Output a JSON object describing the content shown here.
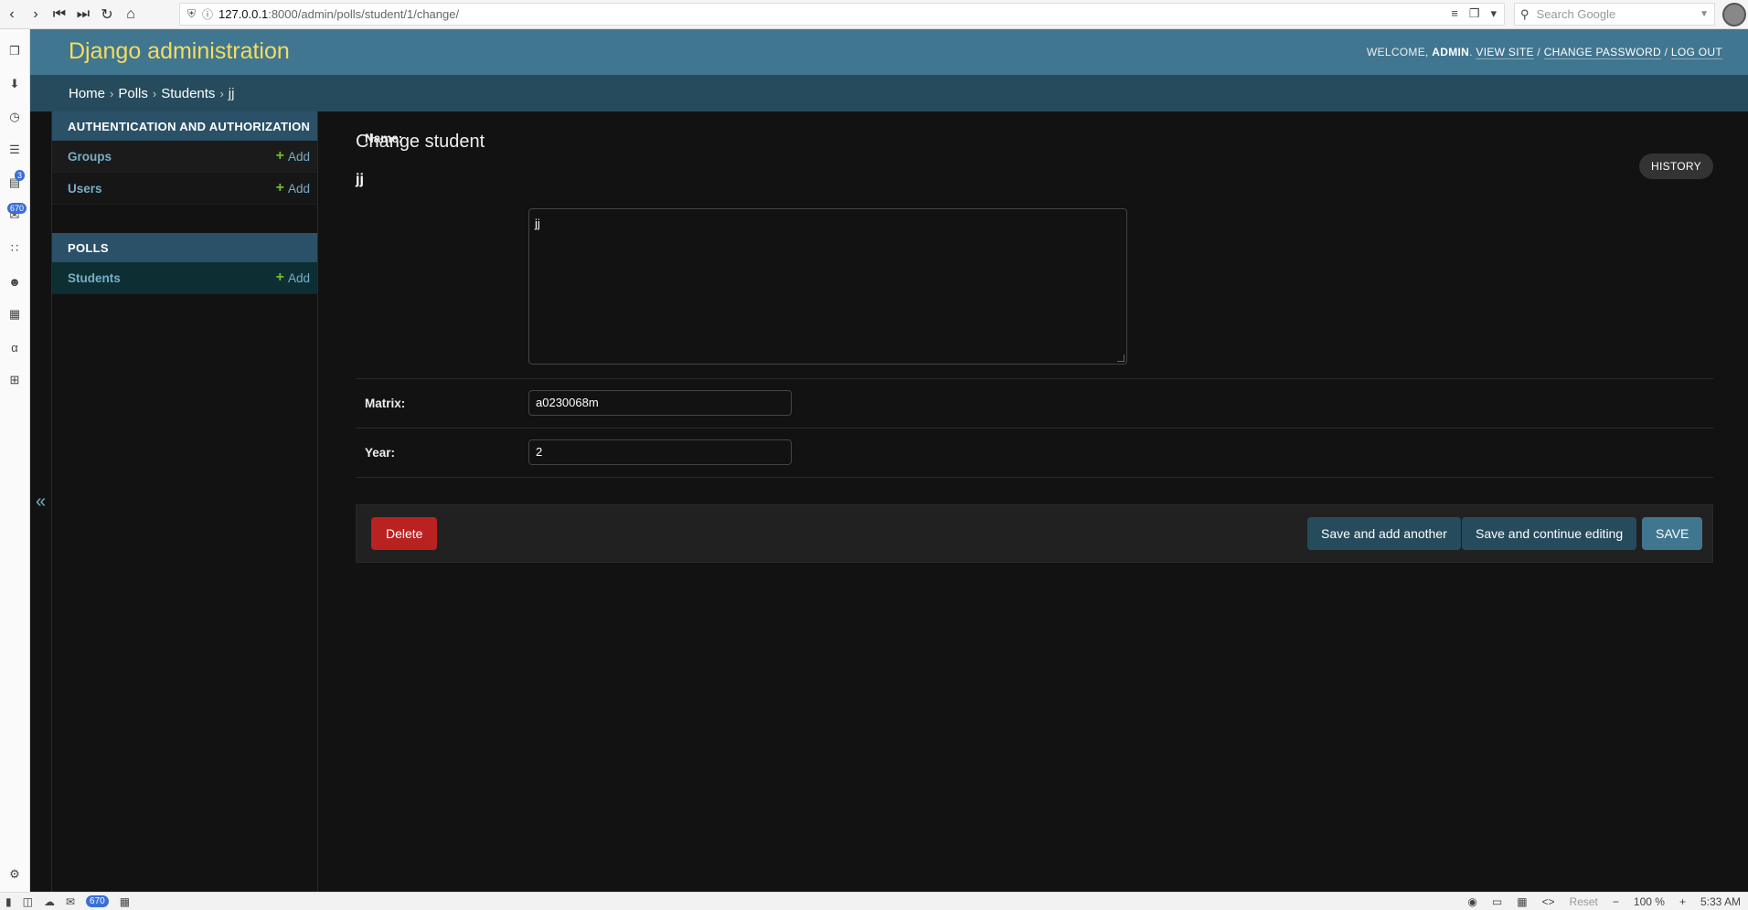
{
  "browser": {
    "url_host": "127.0.0.1",
    "url_path": ":8000/admin/polls/student/1/change/",
    "search_placeholder": "Search Google",
    "left_badges": [
      "3",
      "670"
    ],
    "status": {
      "mail_badge": "670",
      "reset_label": "Reset",
      "zoom": "100 %",
      "time": "5:33 AM"
    }
  },
  "header": {
    "branding": "Django administration",
    "welcome": "Welcome, ",
    "username": "admin",
    "view_site": "View site",
    "change_password": "Change password",
    "log_out": "Log out",
    "sep": " / "
  },
  "breadcrumbs": {
    "home": "Home",
    "app": "Polls",
    "model": "Students",
    "object": "jj",
    "sep": "›"
  },
  "sidebar": {
    "toggle": "«",
    "modules": [
      {
        "caption": "Authentication and Authorization",
        "models": [
          {
            "name": "Groups",
            "add": "Add"
          },
          {
            "name": "Users",
            "add": "Add"
          }
        ]
      },
      {
        "caption": "Polls",
        "models": [
          {
            "name": "Students",
            "add": "Add"
          }
        ]
      }
    ]
  },
  "content": {
    "title": "Change student",
    "object": "jj",
    "history": "History",
    "fields": {
      "name_label": "Name:",
      "name_value": "jj",
      "matrix_label": "Matrix:",
      "matrix_value": "a0230068m",
      "year_label": "Year:",
      "year_value": "2"
    },
    "actions": {
      "delete": "Delete",
      "save_add_another": "Save and add another",
      "save_continue": "Save and continue editing",
      "save": "SAVE"
    }
  }
}
